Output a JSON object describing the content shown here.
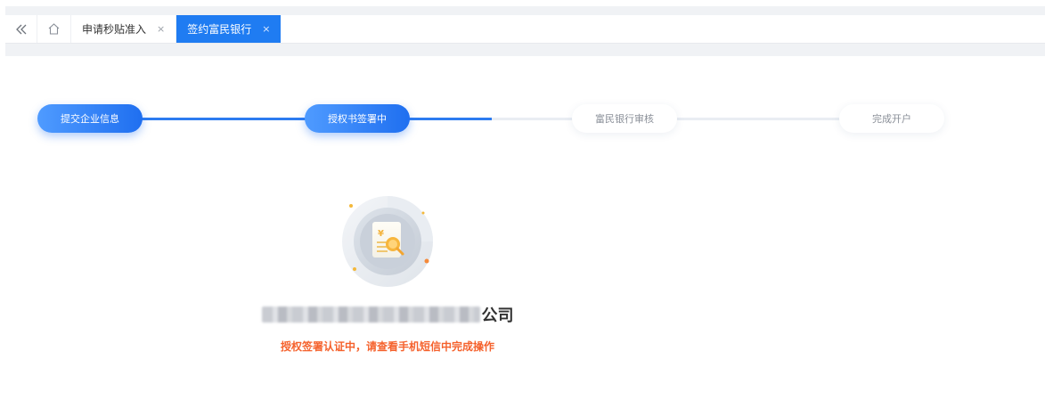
{
  "tabs": {
    "items": [
      {
        "label": "申请秒贴准入",
        "close": "×"
      },
      {
        "label": "签约富民银行",
        "close": "×"
      }
    ]
  },
  "stepper": {
    "steps": [
      {
        "label": "提交企业信息",
        "state": "done"
      },
      {
        "label": "授权书签署中",
        "state": "active"
      },
      {
        "label": "富民银行审核",
        "state": "pending"
      },
      {
        "label": "完成开户",
        "state": "pending"
      }
    ]
  },
  "result": {
    "company_suffix": "公司",
    "status": "授权签署认证中，请查看手机短信中完成操作"
  },
  "colors": {
    "primary": "#1f7cf2",
    "warning": "#f5622d"
  },
  "icons": {
    "collapse": "double-chevron-left-icon",
    "home": "home-icon",
    "illustration": "certificate-stamp-icon"
  }
}
